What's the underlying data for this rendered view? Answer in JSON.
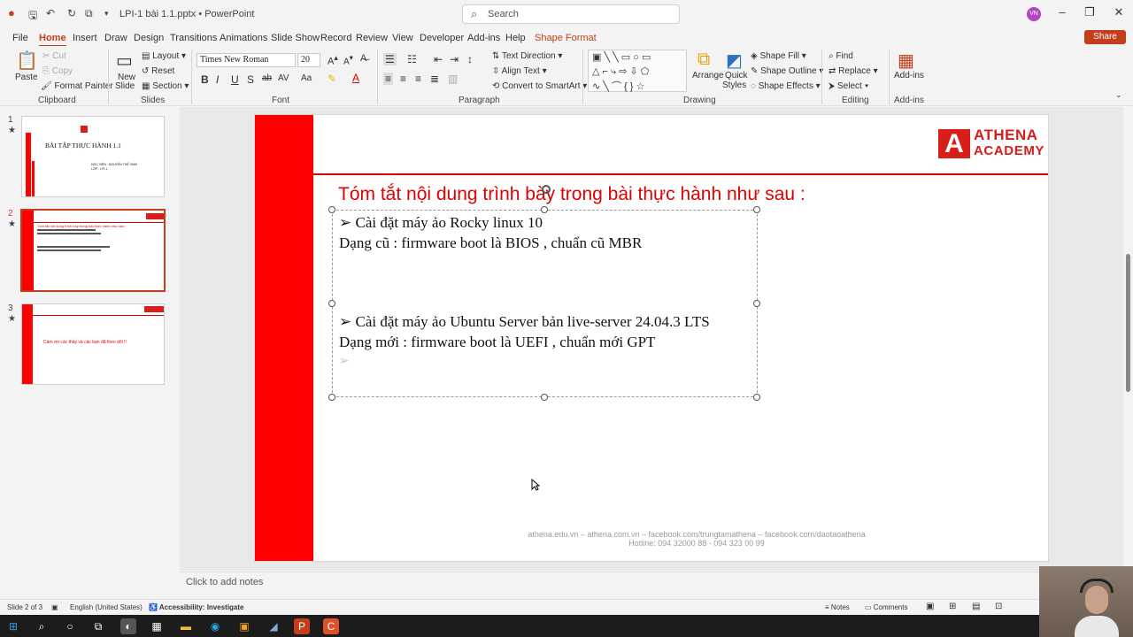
{
  "app": {
    "file_name": "LPI-1 bài 1.1.pptx",
    "sep": "•",
    "app_name": "PowerPoint",
    "search_placeholder": "Search",
    "user_initials": "VN",
    "share_label": "Share"
  },
  "menu": {
    "tabs": [
      "File",
      "Home",
      "Insert",
      "Draw",
      "Design",
      "Transitions",
      "Animations",
      "Slide Show",
      "Record",
      "Review",
      "View",
      "Developer",
      "Add-ins",
      "Help",
      "Shape Format"
    ],
    "active": "Home"
  },
  "ribbon": {
    "clipboard": {
      "paste": "Paste",
      "cut": "Cut",
      "copy": "Copy",
      "format_painter": "Format Painter",
      "group": "Clipboard"
    },
    "slides": {
      "new_slide": "New",
      "new_slide2": "Slide",
      "layout": "Layout",
      "reset": "Reset",
      "section": "Section",
      "group": "Slides"
    },
    "font": {
      "font_name": "Times New Roman",
      "font_size": "20",
      "group": "Font"
    },
    "paragraph": {
      "text_direction": "Text Direction",
      "align_text": "Align Text",
      "convert_smartart": "Convert to SmartArt",
      "group": "Paragraph"
    },
    "drawing": {
      "arrange": "Arrange",
      "quick_styles": "Quick",
      "quick_styles2": "Styles",
      "shape_fill": "Shape Fill",
      "shape_outline": "Shape Outline",
      "shape_effects": "Shape Effects",
      "group": "Drawing"
    },
    "editing": {
      "find": "Find",
      "replace": "Replace",
      "select": "Select",
      "group": "Editing"
    },
    "addins": {
      "label": "Add-ins",
      "group": "Add-ins"
    }
  },
  "thumbnails": [
    {
      "num": "1",
      "star": "★",
      "title": "BÀI TẬP THỰC HÀNH 1.1",
      "line1": "HỌC VIÊN : NGUYỄN THẾ VINH",
      "line2": "LỚP : LPI-1"
    },
    {
      "num": "2",
      "star": "★",
      "title": "Tóm tắt nội dung trình bày trong bài thực hành như sau :"
    },
    {
      "num": "3",
      "star": "★",
      "title": "Cảm ơn các thầy và các bạn đã theo dõi !!"
    }
  ],
  "slide": {
    "logo_line1": "ATHENA",
    "logo_line2": "ACADEMY",
    "logo_letter": "A",
    "title": "Tóm tắt nội dung trình bày trong bài thực hành như sau :",
    "bullet_char": "➢",
    "item1_title": "Cài đặt máy ảo Rocky linux 10",
    "item1_detail": "Dạng cũ  : firmware  boot là BIOS , chuẩn cũ MBR",
    "item2_title": "Cài đặt máy ảo Ubuntu Server bản live-server  24.04.3 LTS",
    "item2_detail": "Dạng mới : firmware  boot là UEFI , chuẩn mới GPT",
    "footer_line1": "athena.edu.vn – athena.com.vn – facebook.com/trungtamathena – facebook.com/daotaoathena",
    "footer_line2": "Hotline: 094 32000 88 - 094 323 00 99"
  },
  "notes_placeholder": "Click to add notes",
  "status": {
    "slide_pos": "Slide 2 of 3",
    "language": "English (United States)",
    "accessibility": "Accessibility: Investigate",
    "notes": "Notes",
    "comments": "Comments"
  },
  "colors": {
    "accent": "#c43e1c",
    "slide_red": "#fe0000",
    "title_red": "#e00000"
  }
}
